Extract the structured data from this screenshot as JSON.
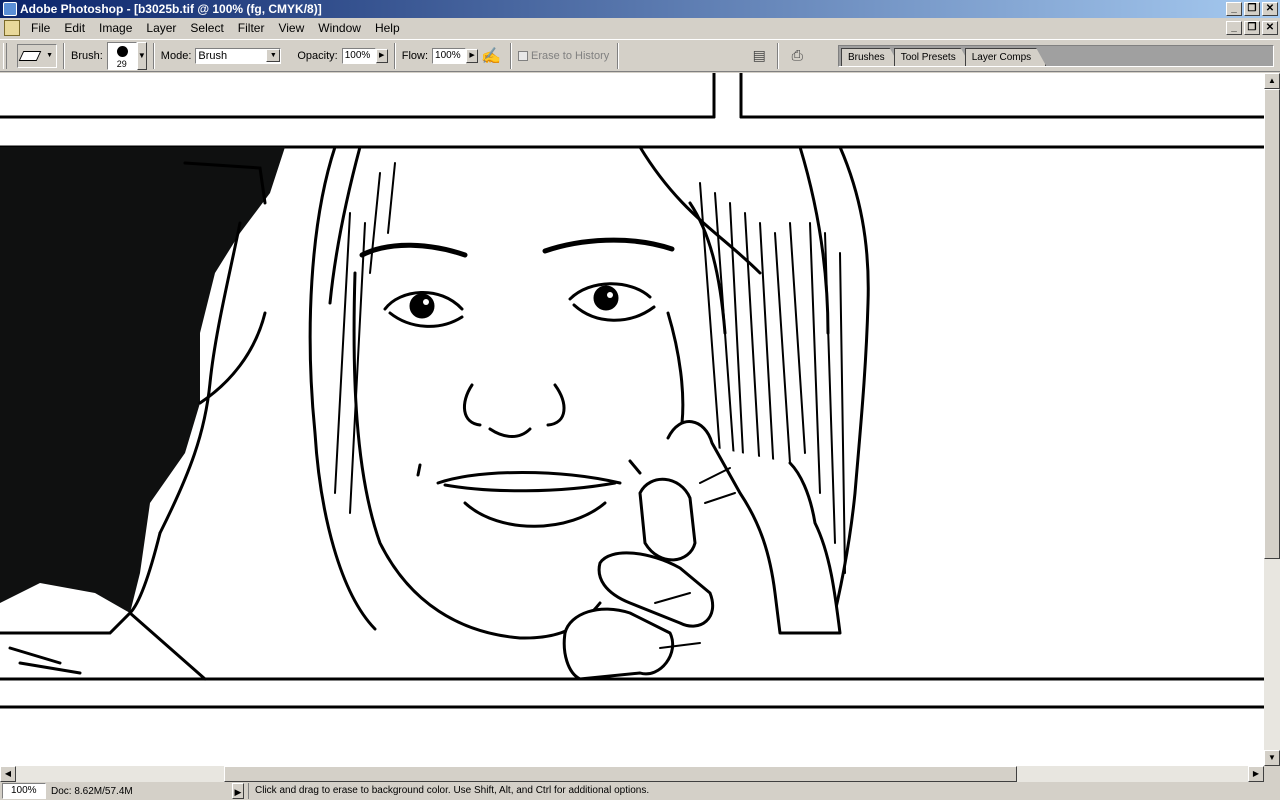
{
  "window": {
    "title": "Adobe Photoshop - [b3025b.tif @ 100% (fg, CMYK/8)]",
    "controls": [
      "minimize-icon",
      "restore-icon",
      "close-icon"
    ]
  },
  "menu": {
    "items": [
      "File",
      "Edit",
      "Image",
      "Layer",
      "Select",
      "Filter",
      "View",
      "Window",
      "Help"
    ]
  },
  "options": {
    "brush_label": "Brush:",
    "brush_size": "29",
    "mode_label": "Mode:",
    "mode_value": "Brush",
    "opacity_label": "Opacity:",
    "opacity_value": "100%",
    "flow_label": "Flow:",
    "flow_value": "100%",
    "erase_to_history": "Erase to History",
    "erase_to_history_checked": false
  },
  "palette_well": {
    "tabs": [
      "Brushes",
      "Tool Presets",
      "Layer Comps"
    ]
  },
  "status": {
    "zoom": "100%",
    "doc_info": "Doc: 8.62M/57.4M",
    "message": "Click and drag to erase to background color.  Use Shift, Alt, and Ctrl for additional options."
  },
  "colors": {
    "titlebar_start": "#0a246a",
    "titlebar_end": "#a6caf0",
    "chrome": "#d4d0c8"
  }
}
